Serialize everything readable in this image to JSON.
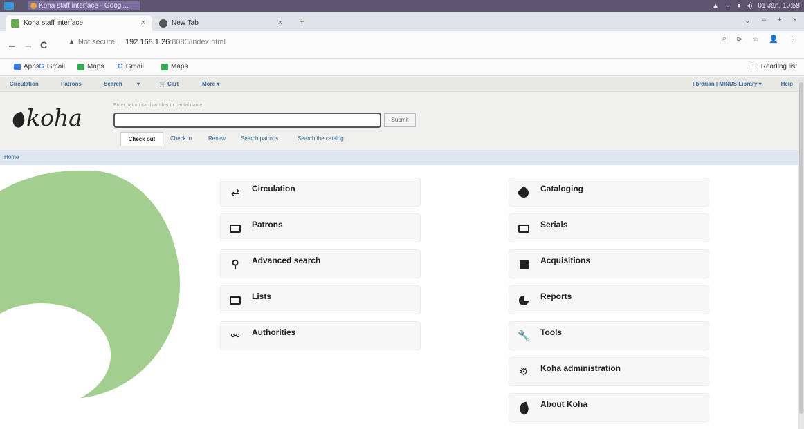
{
  "os": {
    "task_title": "Koha staff interface - Googl...",
    "clock": "01 Jan, 10:58",
    "tray_icons": [
      "user-icon",
      "network-icon",
      "circle-icon",
      "volume-icon"
    ]
  },
  "browser": {
    "tabs": [
      {
        "label": "Koha staff interface",
        "close": "×"
      },
      {
        "label": "New Tab",
        "close": "×"
      }
    ],
    "newtab": "+",
    "window_controls": [
      "⌄",
      "–",
      "+",
      "×"
    ],
    "nav": {
      "back": "←",
      "forward": "→",
      "reload": "C"
    },
    "address": {
      "warn": "▲",
      "not_secure": "Not secure",
      "sep": "|",
      "host": "192.168.1.26",
      "rest": ":8080/index.html"
    },
    "right_icons": [
      "⌕",
      "⊳",
      "☆",
      "👤",
      "⋮"
    ],
    "bookmarks": [
      {
        "label": "Apps",
        "color": "#3f7ad9"
      },
      {
        "label": "Gmail",
        "color": "#4285f4"
      },
      {
        "label": "Maps",
        "color": "#34a853"
      },
      {
        "label": "Gmail",
        "color": "#4285f4"
      },
      {
        "label": "Maps",
        "color": "#34a853"
      }
    ],
    "reading_list": "Reading list"
  },
  "koha": {
    "topnav": [
      "Circulation",
      "Patrons",
      "Search",
      "▾",
      "🛒 Cart",
      "More ▾"
    ],
    "user": "librarian | MINDS Library ▾",
    "help": "Help",
    "logo": "koha",
    "hint": "Enter patron card number or partial name:",
    "submit": "Submit",
    "subtabs": [
      "Check out",
      "Check in",
      "Renew",
      "Search patrons",
      "Search the catalog"
    ],
    "breadcrumb": "Home"
  },
  "modules_left": [
    {
      "label": "Circulation",
      "icon": "⇄"
    },
    {
      "label": "Patrons",
      "icon": "box"
    },
    {
      "label": "Advanced search",
      "icon": "🔍"
    },
    {
      "label": "Lists",
      "icon": "box"
    },
    {
      "label": "Authorities",
      "icon": "⚯"
    }
  ],
  "modules_right": [
    {
      "label": "Cataloging",
      "icon": "tag"
    },
    {
      "label": "Serials",
      "icon": "box"
    },
    {
      "label": "Acquisitions",
      "icon": "gift"
    },
    {
      "label": "Reports",
      "icon": "pie"
    },
    {
      "label": "Tools",
      "icon": "🔧"
    },
    {
      "label": "Koha administration",
      "icon": "⚙"
    },
    {
      "label": "About Koha",
      "icon": "leaf"
    }
  ]
}
